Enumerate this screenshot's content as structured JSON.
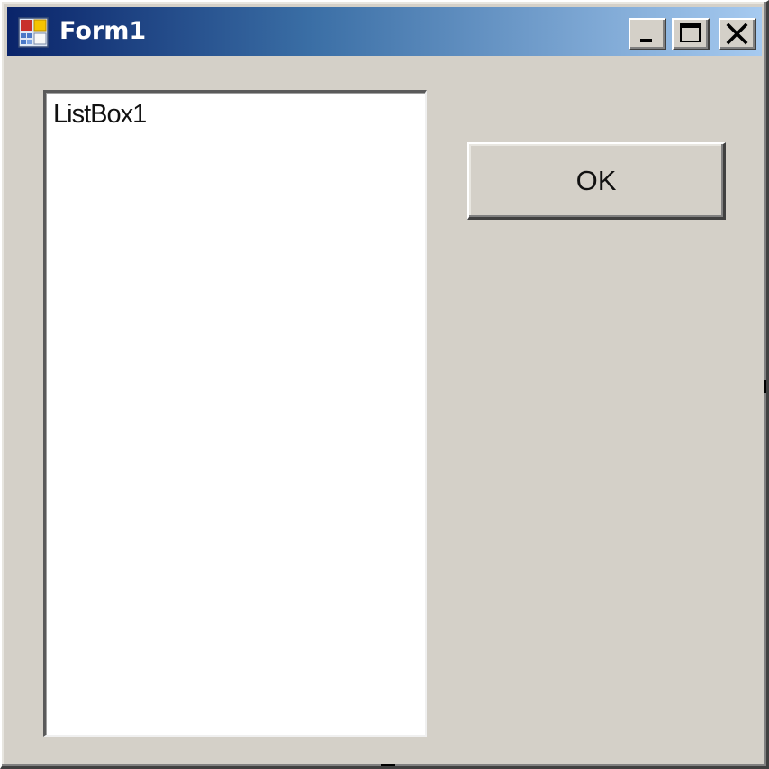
{
  "window": {
    "title": "Form1",
    "icon": "form-app-icon"
  },
  "caption_buttons": {
    "minimize_icon": "minimize-icon",
    "maximize_icon": "maximize-icon",
    "close_icon": "close-icon"
  },
  "listbox": {
    "items": [
      "ListBox1"
    ]
  },
  "ok_button": {
    "label": "OK"
  },
  "colors": {
    "titlebar_start": "#0a246a",
    "titlebar_end": "#a6caf0",
    "face": "#d4d0c8",
    "listbox_bg": "#ffffff"
  }
}
